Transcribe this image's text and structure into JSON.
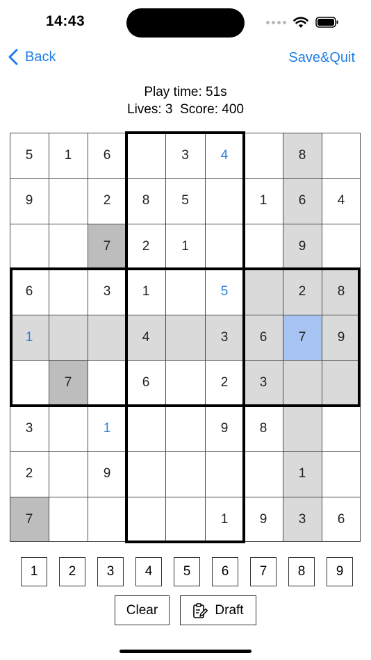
{
  "status": {
    "time": "14:43"
  },
  "nav": {
    "back_label": "Back",
    "save_quit_label": "Save&Quit"
  },
  "info": {
    "play_time": "Play time: 51s",
    "lives": "Lives: 3",
    "score": "Score: 400"
  },
  "board": {
    "rows": [
      [
        "5",
        "1",
        "6",
        "",
        "3",
        "4",
        "",
        "8",
        ""
      ],
      [
        "9",
        "",
        "2",
        "8",
        "5",
        "",
        "1",
        "6",
        "4"
      ],
      [
        "",
        "",
        "7",
        "2",
        "1",
        "",
        "",
        "9",
        ""
      ],
      [
        "6",
        "",
        "3",
        "1",
        "",
        "5",
        "",
        "2",
        "8"
      ],
      [
        "1",
        "",
        "",
        "4",
        "",
        "3",
        "6",
        "7",
        "9"
      ],
      [
        "",
        "7",
        "",
        "6",
        "",
        "2",
        "3",
        "",
        ""
      ],
      [
        "3",
        "",
        "1",
        "",
        "",
        "9",
        "8",
        "",
        ""
      ],
      [
        "2",
        "",
        "9",
        "",
        "",
        "",
        "",
        "1",
        ""
      ],
      [
        "7",
        "",
        "",
        "",
        "",
        "1",
        "9",
        "3",
        "6"
      ]
    ],
    "highlight": [
      [
        "",
        "",
        "",
        "",
        "",
        "",
        "",
        "g",
        ""
      ],
      [
        "",
        "",
        "",
        "",
        "",
        "",
        "",
        "g",
        ""
      ],
      [
        "",
        "",
        "d",
        "",
        "",
        "",
        "",
        "g",
        ""
      ],
      [
        "",
        "",
        "",
        "",
        "",
        "",
        "g",
        "g",
        "g"
      ],
      [
        "g",
        "g",
        "g",
        "g",
        "g",
        "g",
        "g",
        "s",
        "g"
      ],
      [
        "",
        "d",
        "",
        "",
        "",
        "",
        "g",
        "g",
        "g"
      ],
      [
        "",
        "",
        "",
        "",
        "",
        "",
        "",
        "g",
        ""
      ],
      [
        "",
        "",
        "",
        "",
        "",
        "",
        "",
        "g",
        ""
      ],
      [
        "d",
        "",
        "",
        "",
        "",
        "",
        "",
        "g",
        ""
      ]
    ],
    "blue_cells": [
      [
        0,
        5
      ],
      [
        3,
        5
      ],
      [
        4,
        0
      ],
      [
        6,
        2
      ]
    ],
    "colors": {
      "selected": "#a6c3f2",
      "highlight": "#dadada",
      "same_number": "#bdbdbd",
      "user_digit": "#2d7fdc",
      "accent": "#1f7ee8"
    }
  },
  "number_pad": [
    "1",
    "2",
    "3",
    "4",
    "5",
    "6",
    "7",
    "8",
    "9"
  ],
  "actions": {
    "clear_label": "Clear",
    "draft_label": "Draft",
    "draft_icon": "clipboard-pencil-icon"
  }
}
